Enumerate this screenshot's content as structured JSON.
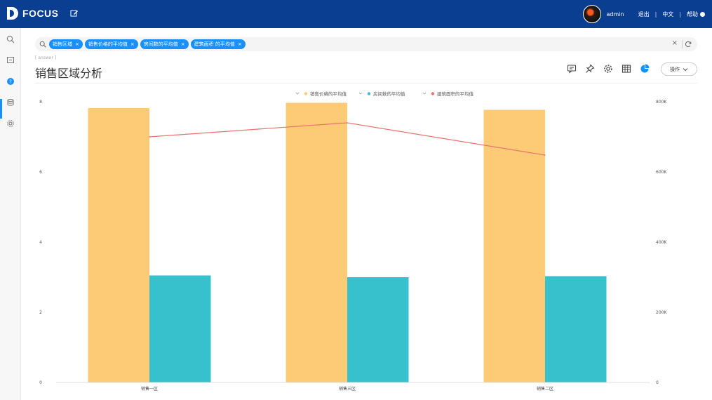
{
  "app": {
    "name": "FOCUS"
  },
  "topbar": {
    "user": "admin",
    "logout": "退出",
    "language": "中文",
    "help": "帮助"
  },
  "search": {
    "chips": [
      {
        "label": "销售区域"
      },
      {
        "label": "销售价格的平均值"
      },
      {
        "label": "房间数的平均值"
      },
      {
        "label": "建筑面积 的平均值"
      }
    ],
    "chip_close": "×",
    "clear": "×"
  },
  "page": {
    "answer_tag": "[ answer ]",
    "title": "销售区域分析",
    "ops_button": "操作"
  },
  "colors": {
    "bar1": "#fdca76",
    "bar2": "#36c1cc",
    "line": "#e8736f",
    "topbar": "#0a3e91",
    "chip": "#1890ff"
  },
  "chart_data": {
    "type": "bar",
    "categories": [
      "销售一区",
      "销售三区",
      "销售二区"
    ],
    "series": [
      {
        "name": "销售价格的平均值",
        "kind": "bar",
        "axis": "left",
        "values": [
          7.82,
          7.97,
          7.77
        ]
      },
      {
        "name": "房间数的平均值",
        "kind": "bar",
        "axis": "left",
        "values": [
          3.05,
          3.0,
          3.03
        ]
      },
      {
        "name": "建筑面积的平均值",
        "kind": "line",
        "axis": "right",
        "values": [
          700000,
          740000,
          648000
        ]
      }
    ],
    "ylim_left": [
      0,
      8
    ],
    "ylim_right": [
      0,
      800000
    ],
    "yticks_left": [
      "0",
      "2",
      "4",
      "6",
      "8"
    ],
    "yticks_right": [
      "0",
      "200K",
      "400K",
      "600K",
      "800K"
    ],
    "legend_position": "top-center",
    "grid": false
  }
}
